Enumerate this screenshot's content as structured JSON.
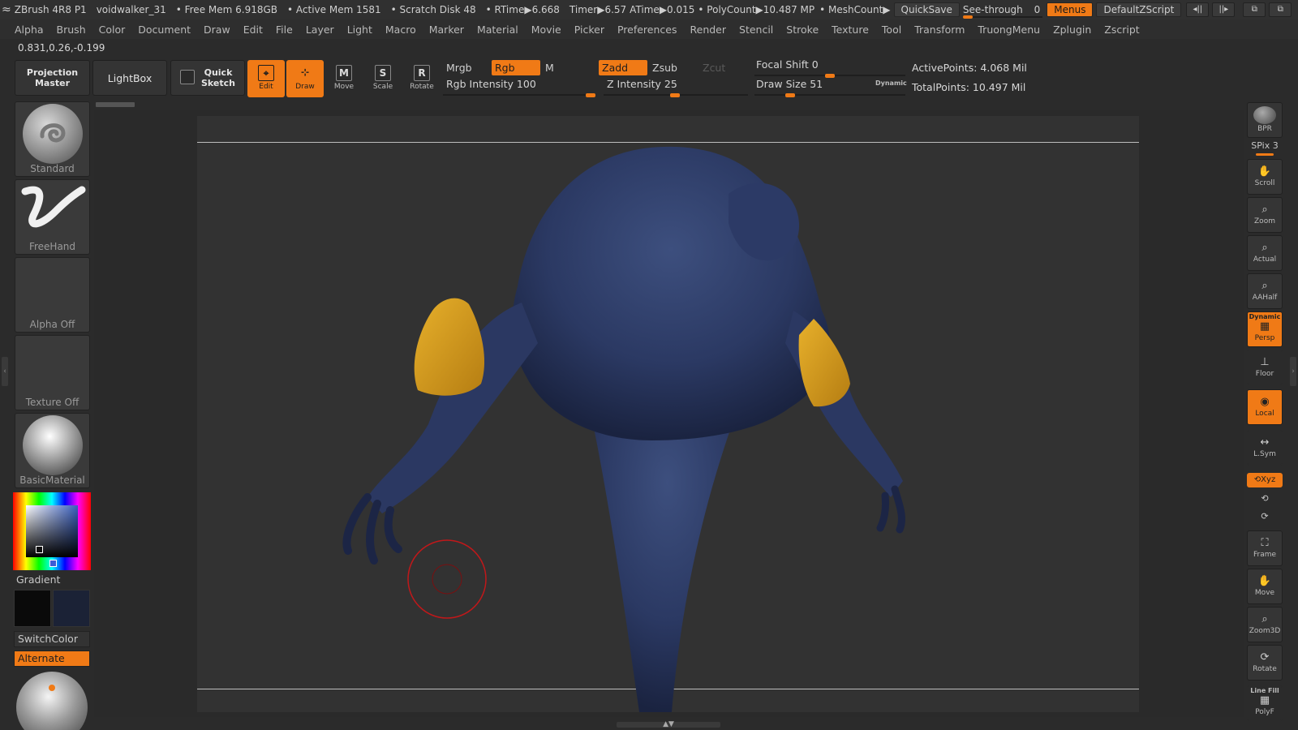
{
  "title_bar": {
    "app": "ZBrush 4R8 P1",
    "document": "voidwalker_31",
    "free_mem": "• Free Mem 6.918GB",
    "active_mem": "• Active Mem 1581",
    "scratch_disk": "• Scratch Disk 48",
    "rtime": "• RTime▶6.668",
    "timer": "Timer▶6.57",
    "atime": "ATime▶0.015",
    "polycount": "• PolyCount▶10.487 MP",
    "meshcount": "• MeshCount▶",
    "quicksave": "QuickSave",
    "see_through": "See-through",
    "see_through_value": "0",
    "menus": "Menus",
    "default_zscript": "DefaultZScript"
  },
  "menu": [
    "Alpha",
    "Brush",
    "Color",
    "Document",
    "Draw",
    "Edit",
    "File",
    "Layer",
    "Light",
    "Macro",
    "Marker",
    "Material",
    "Movie",
    "Picker",
    "Preferences",
    "Render",
    "Stencil",
    "Stroke",
    "Texture",
    "Tool",
    "Transform",
    "TruongMenu",
    "Zplugin",
    "Zscript"
  ],
  "coords": "0.831,0.26,-0.199",
  "toolbar": {
    "projection_master": "Projection Master",
    "lightbox": "LightBox",
    "quick_sketch": "Quick Sketch",
    "edit": "Edit",
    "draw": "Draw",
    "move": "Move",
    "scale": "Scale",
    "rotate": "Rotate",
    "mrgb": "Mrgb",
    "rgb": "Rgb",
    "m": "M",
    "rgb_intensity": "Rgb Intensity 100",
    "zadd": "Zadd",
    "zsub": "Zsub",
    "zcut": "Zcut",
    "z_intensity": "Z Intensity 25",
    "focal_shift": "Focal Shift 0",
    "draw_size": "Draw Size 51",
    "dynamic": "Dynamic",
    "active_points": "ActivePoints: 4.068 Mil",
    "total_points": "TotalPoints: 10.497 Mil"
  },
  "sliders": {
    "see_through": 0,
    "rgb_intensity": 100,
    "z_intensity": 25,
    "focal_shift": 0,
    "draw_size": 51
  },
  "left_shelf": {
    "brush": "Standard",
    "stroke": "FreeHand",
    "alpha": "Alpha Off",
    "texture": "Texture Off",
    "material": "BasicMaterial",
    "gradient": "Gradient",
    "switch_color": "SwitchColor",
    "alternate": "Alternate"
  },
  "right_shelf": {
    "bpr": "BPR",
    "spix": "SPix 3",
    "scroll": "Scroll",
    "zoom": "Zoom",
    "actual": "Actual",
    "aahalf": "AAHalf",
    "dynamic": "Dynamic",
    "persp": "Persp",
    "floor": "Floor",
    "local": "Local",
    "lsym": "L.Sym",
    "xyz": "Xyz",
    "frame": "Frame",
    "move": "Move",
    "zoom3d": "Zoom3D",
    "rotate": "Rotate",
    "line_fill": "Line Fill",
    "polyf": "PolyF"
  },
  "colors": {
    "accent": "#f07a16",
    "model_body": "#2e3d63",
    "model_bracers": "#d39b1e",
    "primary_color": "#0a0a0a",
    "secondary_color": "#1b2236"
  },
  "icons": {
    "app_logo": "zbrush-logo-icon",
    "edit": "edit-icon",
    "draw": "draw-icon",
    "move": "move-icon",
    "scale": "scale-icon",
    "rotate": "rotate-icon"
  }
}
